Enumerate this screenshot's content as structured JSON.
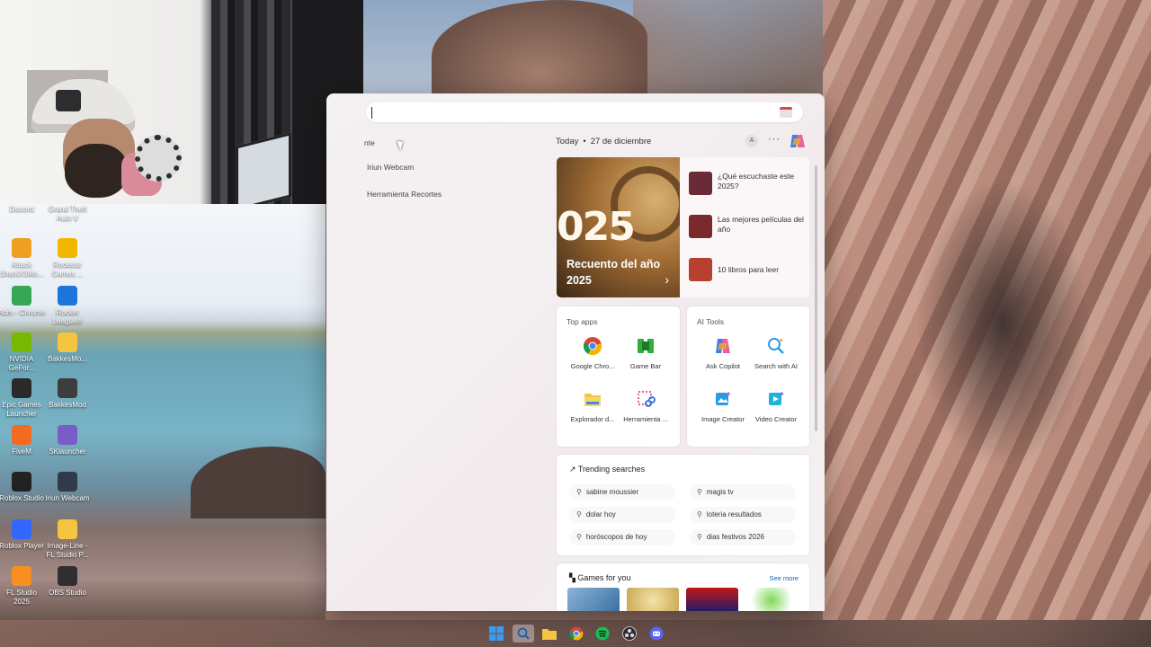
{
  "desktop": {
    "icons": [
      {
        "label": "Discord",
        "icon": "discord-icon",
        "color": "#5865f2"
      },
      {
        "label": "Grand Theft Auto V",
        "icon": "gta-icon",
        "color": "#2b2b2b"
      },
      {
        "label": "Attack SharkX3Mo...",
        "icon": "attack-shark-icon",
        "color": "#f0a020"
      },
      {
        "label": "Rockstar Games ...",
        "icon": "rockstar-icon",
        "color": "#f3b600"
      },
      {
        "label": "Adm - Chrome",
        "icon": "chrome-icon",
        "color": "#34a853"
      },
      {
        "label": "Rocket League®",
        "icon": "rocket-league-icon",
        "color": "#1c75d8"
      },
      {
        "label": "NVIDIA GeFor...",
        "icon": "nvidia-icon",
        "color": "#76b900"
      },
      {
        "label": "BakkesMo...",
        "icon": "folder-icon",
        "color": "#f5c542"
      },
      {
        "label": "Epic Games Launcher",
        "icon": "epic-games-icon",
        "color": "#2a2a2a"
      },
      {
        "label": "BakkesMod",
        "icon": "bakkesmod-icon",
        "color": "#3d3d3d"
      },
      {
        "label": "FiveM",
        "icon": "fivem-icon",
        "color": "#f36b21"
      },
      {
        "label": "SKlauncher",
        "icon": "sklauncher-icon",
        "color": "#7a5cc8"
      },
      {
        "label": "Roblox Studio",
        "icon": "roblox-studio-icon",
        "color": "#222222"
      },
      {
        "label": "Iriun Webcam",
        "icon": "iriun-webcam-icon",
        "color": "#303a4a"
      },
      {
        "label": "Roblox Player",
        "icon": "roblox-player-icon",
        "color": "#3366ff"
      },
      {
        "label": "Image-Line - FL Studio P...",
        "icon": "folder-icon",
        "color": "#f5c542"
      },
      {
        "label": "FL Studio 2025",
        "icon": "fl-studio-icon",
        "color": "#f7901e"
      },
      {
        "label": "OBS Studio",
        "icon": "obs-icon",
        "color": "#302e31"
      }
    ]
  },
  "search": {
    "placeholder": "",
    "recent_label": "nte",
    "recent_items": [
      "Iriun Webcam",
      "Herramienta Recortes"
    ]
  },
  "today": {
    "label": "Today",
    "date": "27 de diciembre",
    "user_initial": "A",
    "more": "···"
  },
  "hero": {
    "year_text": "025",
    "title": "Recuento del año 2025",
    "chevron": "›",
    "list": [
      {
        "text": "¿Qué escuchaste este 2025?",
        "thumb_color": "#6a2a36"
      },
      {
        "text": "Las mejores películas del año",
        "thumb_color": "#7a2a2a"
      },
      {
        "text": "10 libros para leer",
        "thumb_color": "#b8402e"
      }
    ]
  },
  "top_apps": {
    "label": "Top apps",
    "apps": [
      {
        "label": "Google Chro...",
        "icon": "chrome-icon"
      },
      {
        "label": "Game Bar",
        "icon": "game-bar-icon"
      },
      {
        "label": "Explorador d...",
        "icon": "file-explorer-icon"
      },
      {
        "label": "Herramienta ...",
        "icon": "snipping-tool-icon"
      }
    ]
  },
  "ai_tools": {
    "label": "AI Tools",
    "tools": [
      {
        "label": "Ask Copilot",
        "icon": "copilot-icon"
      },
      {
        "label": "Search with AI",
        "icon": "ai-search-icon"
      },
      {
        "label": "Image Creator",
        "icon": "image-creator-icon"
      },
      {
        "label": "Video Creator",
        "icon": "video-creator-icon"
      }
    ]
  },
  "trending": {
    "label": "Trending searches",
    "items": [
      "sabine moussier",
      "magis tv",
      "dolar hoy",
      "loteria resultados",
      "horóscopos de hoy",
      "dias festivos 2026"
    ]
  },
  "games": {
    "label": "Games for you",
    "see_more": "See more"
  },
  "taskbar": {
    "icons": [
      "windows-start-icon",
      "search-icon",
      "file-explorer-icon",
      "chrome-icon",
      "spotify-icon",
      "obs-icon",
      "discord-icon"
    ]
  },
  "colors": {
    "accent": "#1a5fb4",
    "panel_bg": "#f4f1f3"
  }
}
